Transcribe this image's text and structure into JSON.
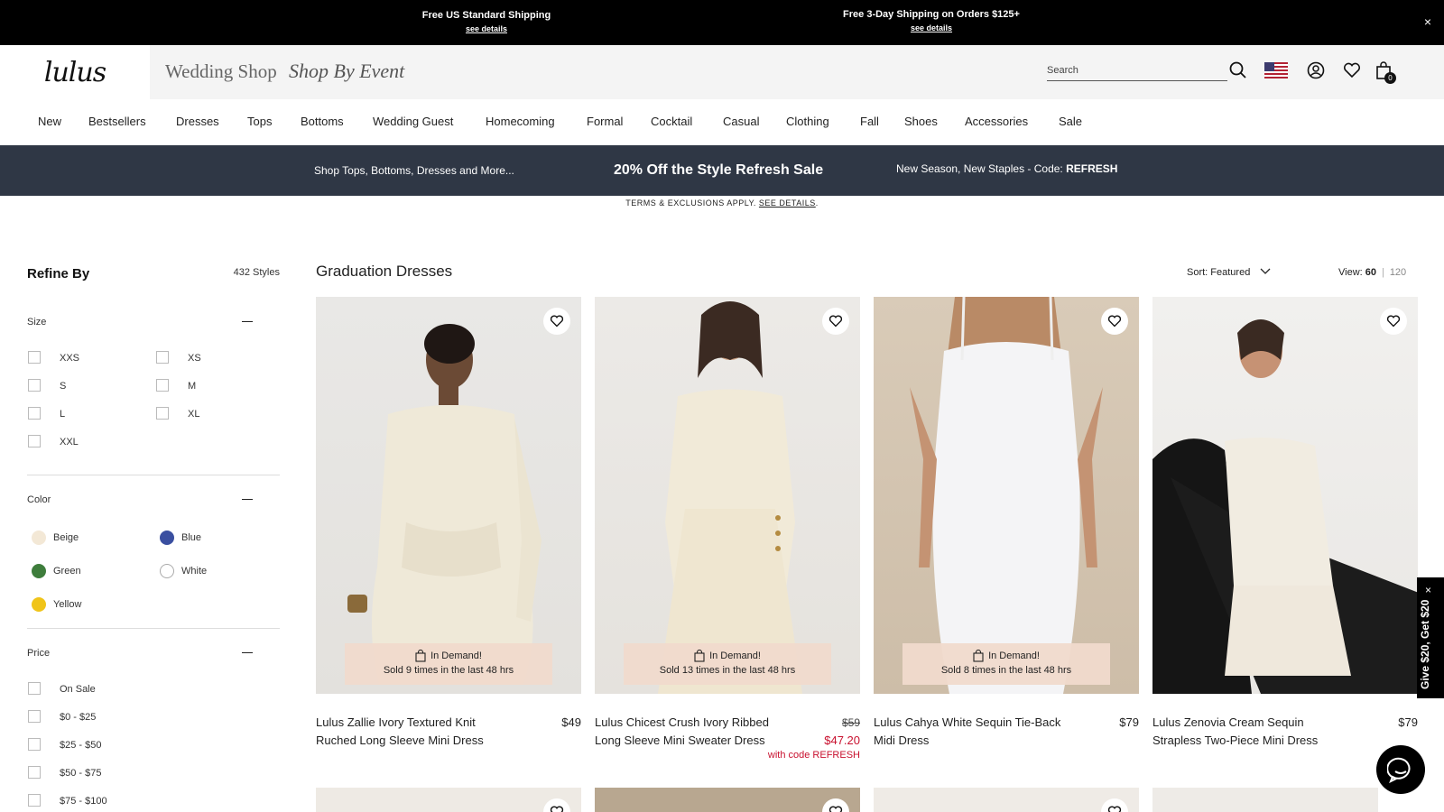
{
  "topbar": {
    "left_title": "Free US Standard Shipping",
    "left_link": "see details",
    "right_title": "Free 3-Day Shipping on Orders $125+",
    "right_link": "see details",
    "close": "×"
  },
  "header": {
    "logo": "lulus",
    "wedding_shop": "Wedding Shop",
    "shop_by_event": "Shop By Event",
    "search_placeholder": "Search",
    "cart_count": "0"
  },
  "nav": [
    "New",
    "Bestsellers",
    "Dresses",
    "Tops",
    "Bottoms",
    "Wedding Guest",
    "Homecoming",
    "Formal",
    "Cocktail",
    "Casual",
    "Clothing",
    "Fall",
    "Shoes",
    "Accessories",
    "Sale"
  ],
  "promo": {
    "left": "Shop Tops, Bottoms, Dresses and More...",
    "center": "20% Off the Style Refresh Sale",
    "right_text": "New Season, New Staples - Code: ",
    "right_code": "REFRESH",
    "terms": "TERMS & EXCLUSIONS APPLY. ",
    "terms_link": "SEE DETAILS",
    "terms_end": "."
  },
  "sidebar": {
    "title": "Refine By",
    "count": "432 Styles",
    "size_title": "Size",
    "sizes": [
      "XXS",
      "XS",
      "S",
      "M",
      "L",
      "XL",
      "XXL"
    ],
    "color_title": "Color",
    "colors": [
      {
        "name": "Beige",
        "hex": "#f3e8d6"
      },
      {
        "name": "Blue",
        "hex": "#3a4fa0"
      },
      {
        "name": "Green",
        "hex": "#3e7d3c"
      },
      {
        "name": "White",
        "hex": "#ffffff"
      },
      {
        "name": "Yellow",
        "hex": "#f0c419"
      }
    ],
    "price_title": "Price",
    "prices": [
      "On Sale",
      "$0 - $25",
      "$25 - $50",
      "$50 - $75",
      "$75 - $100"
    ]
  },
  "main": {
    "title": "Graduation Dresses",
    "sort_label": "Sort: Featured",
    "view_label": "View:",
    "view_selected": "60",
    "view_separator": "|",
    "view_alt": "120"
  },
  "products": [
    {
      "name": "Lulus Zallie Ivory Textured Knit Ruched Long Sleeve Mini Dress",
      "price": "$49",
      "badge_title": "In Demand!",
      "badge_text": "Sold 9 times in the last 48 hrs"
    },
    {
      "name": "Lulus Chicest Crush Ivory Ribbed Long Sleeve Mini Sweater Dress",
      "old_price": "$59",
      "sale_price": "$47.20",
      "code": "with code REFRESH",
      "badge_title": "In Demand!",
      "badge_text": "Sold 13 times in the last 48 hrs"
    },
    {
      "name": "Lulus Cahya White Sequin Tie-Back Midi Dress",
      "price": "$79",
      "badge_title": "In Demand!",
      "badge_text": "Sold 8 times in the last 48 hrs"
    },
    {
      "name": "Lulus Zenovia Cream Sequin Strapless Two-Piece Mini Dress",
      "price": "$79"
    }
  ],
  "floating": {
    "give": "Give $20, Get $20",
    "close": "×"
  },
  "colors": {
    "promo_bg": "#2f3745",
    "sale_red": "#c8102e",
    "badge_bg": "#f0dacc"
  }
}
